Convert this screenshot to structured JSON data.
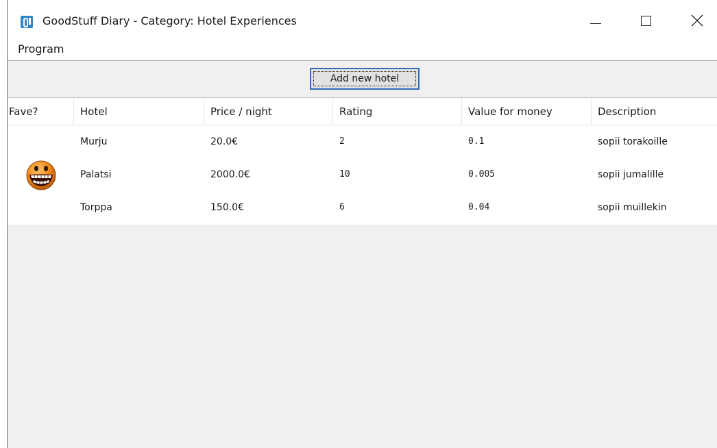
{
  "window": {
    "title": "GoodStuff Diary - Category: Hotel Experiences",
    "app_icon": "diary-app-icon",
    "controls": {
      "minimize": "minimize-icon",
      "maximize": "maximize-icon",
      "close": "close-icon"
    }
  },
  "menubar": {
    "items": [
      {
        "label": "Program"
      }
    ]
  },
  "toolbar": {
    "add_button_label": "Add new hotel",
    "focus_color": "#2f6bb3"
  },
  "table": {
    "columns": [
      "Fave?",
      "Hotel",
      "Price / night",
      "Rating",
      "Value for money",
      "Description"
    ],
    "rows": [
      {
        "fave": false,
        "hotel": "Murju",
        "price": "20.0€",
        "rating": "2",
        "value": "0.1",
        "description": "sopii torakoille"
      },
      {
        "fave": true,
        "hotel": "Palatsi",
        "price": "2000.0€",
        "rating": "10",
        "value": "0.005",
        "description": "sopii jumalille"
      },
      {
        "fave": false,
        "hotel": "Torppa",
        "price": "150.0€",
        "rating": "6",
        "value": "0.04",
        "description": "sopii muillekin"
      }
    ],
    "fave_icon": "grinning-smiley-icon"
  },
  "colors": {
    "app_icon": "#2f86c8",
    "toolbar_bg": "#f0f0f0",
    "smiley_orange": "#f08a1c"
  }
}
